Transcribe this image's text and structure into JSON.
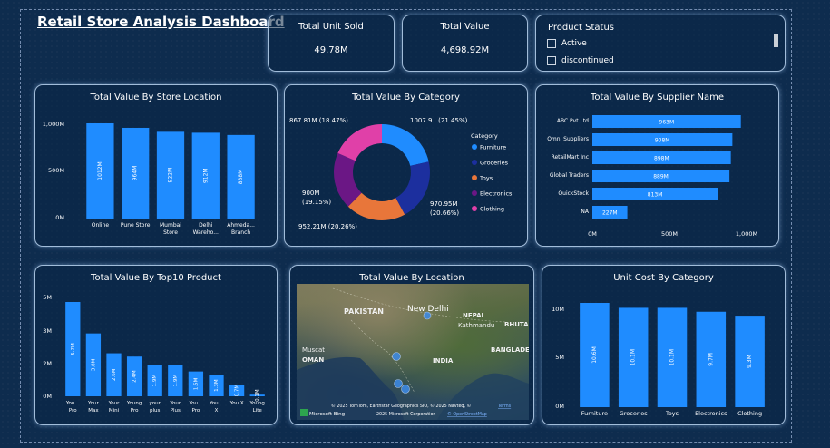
{
  "dashboard": {
    "title": "Retail Store Analysis Dashboard"
  },
  "kpis": [
    {
      "label": "Total Unit Sold",
      "value": "49.78M"
    },
    {
      "label": "Total Value",
      "value": "4,698.92M"
    }
  ],
  "slicer": {
    "title": "Product Status",
    "options": [
      "Active",
      "discontinued"
    ]
  },
  "colors": {
    "bar": "#1f8cff",
    "background": "#0e2c4e",
    "card_border": "#bed7f5",
    "donut": [
      "#1f8cff",
      "#1c2f9e",
      "#e8763a",
      "#6b1785",
      "#e040a8"
    ]
  },
  "charts": {
    "store": {
      "title": "Total Value By Store Location",
      "type": "bar",
      "y_ticks": [
        "1,000M",
        "500M",
        "0M"
      ],
      "ylim": [
        0,
        1000
      ],
      "categories": [
        [
          "Online"
        ],
        [
          "Pune Store"
        ],
        [
          "Mumbai",
          "Store"
        ],
        [
          "Delhi",
          "Wareho..."
        ],
        [
          "Ahmeda...",
          "Branch"
        ]
      ],
      "values": [
        1012,
        964,
        922,
        912,
        888
      ],
      "labels": [
        "1012M",
        "964M",
        "922M",
        "912M",
        "888M"
      ]
    },
    "category": {
      "title": "Total Value By Category",
      "type": "pie",
      "legend_title": "Category",
      "legend": [
        "Furniture",
        "Groceries",
        "Toys",
        "Electronics",
        "Clothing"
      ],
      "values": [
        1007.9,
        970.95,
        952.21,
        900,
        867.81
      ],
      "labels": [
        [
          "1007.9...(21.45%)"
        ],
        [
          "970.95M",
          "(20.66%)"
        ],
        [
          "952.21M (20.26%)"
        ],
        [
          "900M",
          "(19.15%)"
        ],
        [
          "867.81M (18.47%)"
        ]
      ]
    },
    "supplier": {
      "title": "Total Value By Supplier Name",
      "type": "bar",
      "orientation": "horizontal",
      "categories": [
        "ABC Pvt Ltd",
        "Omni Suppliers",
        "RetailMart Inc",
        "Global Traders",
        "QuickStock",
        "NA"
      ],
      "values": [
        963,
        908,
        898,
        889,
        813,
        227
      ],
      "labels": [
        "963M",
        "908M",
        "898M",
        "889M",
        "813M",
        "227M"
      ],
      "x_ticks": [
        "0M",
        "500M",
        "1,000M"
      ],
      "xlim": [
        0,
        1000
      ]
    },
    "product": {
      "title": "Total Value By Top10 Product",
      "type": "bar",
      "y_ticks": [
        "5M",
        "3M",
        "2M",
        "0M"
      ],
      "categories": [
        [
          "You...",
          "Pro"
        ],
        [
          "Your",
          "Max"
        ],
        [
          "Your",
          "Mini"
        ],
        [
          "Young",
          "Pro"
        ],
        [
          "your",
          "plus"
        ],
        [
          "Your",
          "Plus"
        ],
        [
          "You...",
          "Pro"
        ],
        [
          "You...",
          "X"
        ],
        [
          "You X"
        ],
        [
          "Young",
          "Lite"
        ]
      ],
      "values": [
        5.7,
        3.8,
        2.6,
        2.4,
        1.9,
        1.9,
        1.5,
        1.3,
        0.7,
        0.1
      ],
      "labels": [
        "5.7M",
        "3.8M",
        "2.6M",
        "2.4M",
        "1.9M",
        "1.9M",
        "1.5M",
        "1.3M",
        "0.7M",
        "0.1M"
      ]
    },
    "location": {
      "title": "Total Value By Location",
      "map_labels": {
        "pakistan": "PAKISTAN",
        "new_delhi": "New Delhi",
        "nepal": "NEPAL",
        "kathmandu": "Kathmandu",
        "bhutan": "BHUTA",
        "india": "INDIA",
        "muscat": "Muscat",
        "oman": "OMAN",
        "bangladesh": "BANGLADE"
      },
      "attribution": [
        "© 2025 TomTom, Earthstar Geographics SIO, © 2025 Navteq, ©",
        "2025 Microsoft Corporation"
      ],
      "attribution_link": "Terms",
      "microsoft_link": "© OpenStreetMap",
      "bing": "Microsoft Bing"
    },
    "unitcost": {
      "title": "Unit Cost By Category",
      "type": "bar",
      "y_ticks": [
        "10M",
        "5M",
        "0M"
      ],
      "ylim": [
        0,
        10
      ],
      "categories": [
        "Furniture",
        "Groceries",
        "Toys",
        "Electronics",
        "Clothing"
      ],
      "values": [
        10.6,
        10.1,
        10.1,
        9.7,
        9.3
      ],
      "labels": [
        "10.6M",
        "10.1M",
        "10.1M",
        "9.7M",
        "9.3M"
      ]
    }
  }
}
